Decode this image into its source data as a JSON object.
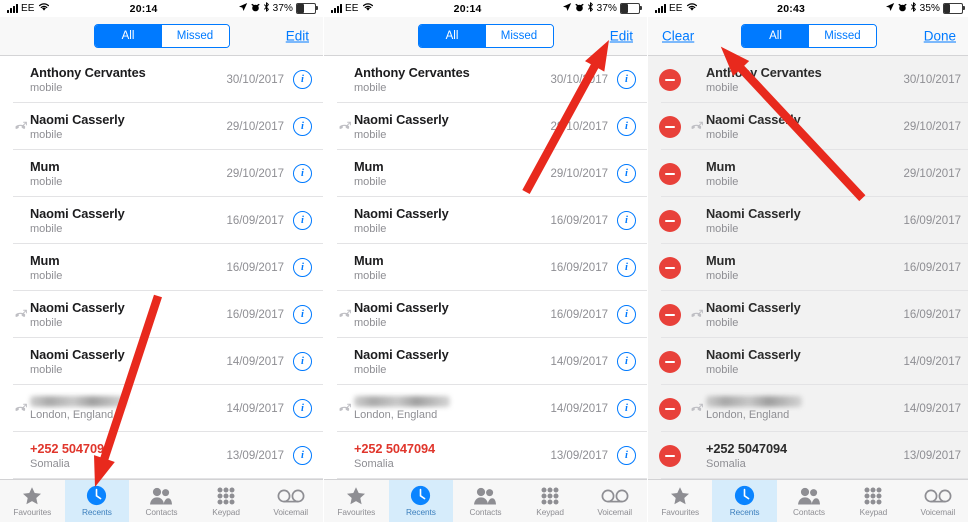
{
  "accent": "#007aff",
  "red": "#e8413a",
  "panels": [
    {
      "id": "panel-recents-default",
      "status": {
        "signal": "signal-bars-icon",
        "carrier": "EE",
        "wifi": "wifi-icon",
        "time": "20:14",
        "location": "location-arrow-icon",
        "alarm": "alarm-icon",
        "bluetooth": "bluetooth-icon",
        "battery_pct": "37%",
        "battery_level": 37
      },
      "nav": {
        "left_label": "",
        "right_label": "Edit",
        "segments": [
          {
            "label": "All",
            "selected": true
          },
          {
            "label": "Missed",
            "selected": false
          }
        ]
      },
      "editing": false,
      "rows": [
        {
          "name": "Anthony Cervantes",
          "sub": "mobile",
          "date": "30/10/2017",
          "missed": false,
          "red": false,
          "blurred": false
        },
        {
          "name": "Naomi Casserly",
          "sub": "mobile",
          "date": "29/10/2017",
          "missed": true,
          "red": false,
          "blurred": false
        },
        {
          "name": "Mum",
          "sub": "mobile",
          "date": "29/10/2017",
          "missed": false,
          "red": false,
          "blurred": false
        },
        {
          "name": "Naomi Casserly",
          "sub": "mobile",
          "date": "16/09/2017",
          "missed": false,
          "red": false,
          "blurred": false
        },
        {
          "name": "Mum",
          "sub": "mobile",
          "date": "16/09/2017",
          "missed": false,
          "red": false,
          "blurred": false
        },
        {
          "name": "Naomi Casserly",
          "sub": "mobile",
          "date": "16/09/2017",
          "missed": true,
          "red": false,
          "blurred": false
        },
        {
          "name": "Naomi Casserly",
          "sub": "mobile",
          "date": "14/09/2017",
          "missed": false,
          "red": false,
          "blurred": false
        },
        {
          "name": "",
          "sub": "London, England",
          "date": "14/09/2017",
          "missed": true,
          "red": false,
          "blurred": true
        },
        {
          "name": "+252 5047094",
          "sub": "Somalia",
          "date": "13/09/2017",
          "missed": false,
          "red": true,
          "blurred": false
        }
      ],
      "tabs": [
        {
          "label": "Favourites",
          "icon": "star-icon",
          "selected": false
        },
        {
          "label": "Recents",
          "icon": "clock-icon",
          "selected": true
        },
        {
          "label": "Contacts",
          "icon": "people-icon",
          "selected": false
        },
        {
          "label": "Keypad",
          "icon": "keypad-icon",
          "selected": false
        },
        {
          "label": "Voicemail",
          "icon": "voicemail-icon",
          "selected": false
        }
      ],
      "annotation": {
        "type": "arrow",
        "points_to": "Recents tab"
      }
    },
    {
      "id": "panel-edit-highlight",
      "status": {
        "signal": "signal-bars-icon",
        "carrier": "EE",
        "wifi": "wifi-icon",
        "time": "20:14",
        "location": "location-arrow-icon",
        "alarm": "alarm-icon",
        "bluetooth": "bluetooth-icon",
        "battery_pct": "37%",
        "battery_level": 37
      },
      "nav": {
        "left_label": "",
        "right_label": "Edit",
        "segments": [
          {
            "label": "All",
            "selected": true
          },
          {
            "label": "Missed",
            "selected": false
          }
        ]
      },
      "editing": false,
      "rows": [
        {
          "name": "Anthony Cervantes",
          "sub": "mobile",
          "date": "30/10/2017",
          "missed": false,
          "red": false,
          "blurred": false
        },
        {
          "name": "Naomi Casserly",
          "sub": "mobile",
          "date": "29/10/2017",
          "missed": true,
          "red": false,
          "blurred": false
        },
        {
          "name": "Mum",
          "sub": "mobile",
          "date": "29/10/2017",
          "missed": false,
          "red": false,
          "blurred": false
        },
        {
          "name": "Naomi Casserly",
          "sub": "mobile",
          "date": "16/09/2017",
          "missed": false,
          "red": false,
          "blurred": false
        },
        {
          "name": "Mum",
          "sub": "mobile",
          "date": "16/09/2017",
          "missed": false,
          "red": false,
          "blurred": false
        },
        {
          "name": "Naomi Casserly",
          "sub": "mobile",
          "date": "16/09/2017",
          "missed": true,
          "red": false,
          "blurred": false
        },
        {
          "name": "Naomi Casserly",
          "sub": "mobile",
          "date": "14/09/2017",
          "missed": false,
          "red": false,
          "blurred": false
        },
        {
          "name": "",
          "sub": "London, England",
          "date": "14/09/2017",
          "missed": true,
          "red": false,
          "blurred": true
        },
        {
          "name": "+252 5047094",
          "sub": "Somalia",
          "date": "13/09/2017",
          "missed": false,
          "red": true,
          "blurred": false
        }
      ],
      "tabs": [
        {
          "label": "Favourites",
          "icon": "star-icon",
          "selected": false
        },
        {
          "label": "Recents",
          "icon": "clock-icon",
          "selected": true
        },
        {
          "label": "Contacts",
          "icon": "people-icon",
          "selected": false
        },
        {
          "label": "Keypad",
          "icon": "keypad-icon",
          "selected": false
        },
        {
          "label": "Voicemail",
          "icon": "voicemail-icon",
          "selected": false
        }
      ],
      "annotation": {
        "type": "arrow",
        "points_to": "Edit button"
      }
    },
    {
      "id": "panel-edit-mode",
      "status": {
        "signal": "signal-bars-icon",
        "carrier": "EE",
        "wifi": "wifi-icon",
        "time": "20:43",
        "location": "location-arrow-icon",
        "alarm": "alarm-icon",
        "bluetooth": "bluetooth-icon",
        "battery_pct": "35%",
        "battery_level": 35
      },
      "nav": {
        "left_label": "Clear",
        "right_label": "Done",
        "segments": [
          {
            "label": "All",
            "selected": true
          },
          {
            "label": "Missed",
            "selected": false
          }
        ]
      },
      "editing": true,
      "rows": [
        {
          "name": "Anthony Cervantes",
          "sub": "mobile",
          "date": "30/10/2017",
          "missed": false,
          "red": false,
          "blurred": false
        },
        {
          "name": "Naomi Casserly",
          "sub": "mobile",
          "date": "29/10/2017",
          "missed": true,
          "red": false,
          "blurred": false
        },
        {
          "name": "Mum",
          "sub": "mobile",
          "date": "29/10/2017",
          "missed": false,
          "red": false,
          "blurred": false
        },
        {
          "name": "Naomi Casserly",
          "sub": "mobile",
          "date": "16/09/2017",
          "missed": false,
          "red": false,
          "blurred": false
        },
        {
          "name": "Mum",
          "sub": "mobile",
          "date": "16/09/2017",
          "missed": false,
          "red": false,
          "blurred": false
        },
        {
          "name": "Naomi Casserly",
          "sub": "mobile",
          "date": "16/09/2017",
          "missed": true,
          "red": false,
          "blurred": false
        },
        {
          "name": "Naomi Casserly",
          "sub": "mobile",
          "date": "14/09/2017",
          "missed": false,
          "red": false,
          "blurred": false
        },
        {
          "name": "",
          "sub": "London, England",
          "date": "14/09/2017",
          "missed": true,
          "red": false,
          "blurred": true
        },
        {
          "name": "+252 5047094",
          "sub": "Somalia",
          "date": "13/09/2017",
          "missed": false,
          "red": true,
          "blurred": false
        }
      ],
      "tabs": [
        {
          "label": "Favourites",
          "icon": "star-icon",
          "selected": false
        },
        {
          "label": "Recents",
          "icon": "clock-icon",
          "selected": true
        },
        {
          "label": "Contacts",
          "icon": "people-icon",
          "selected": false
        },
        {
          "label": "Keypad",
          "icon": "keypad-icon",
          "selected": false
        },
        {
          "label": "Voicemail",
          "icon": "voicemail-icon",
          "selected": false
        }
      ],
      "annotation": {
        "type": "arrow",
        "points_to": "Clear button"
      }
    }
  ]
}
